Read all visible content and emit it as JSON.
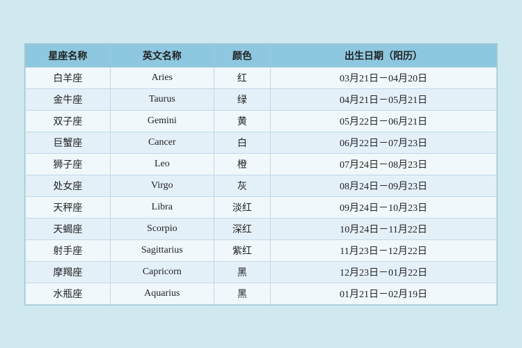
{
  "table": {
    "headers": {
      "cn_name": "星座名称",
      "en_name": "英文名称",
      "color": "颜色",
      "date_range": "出生日期（阳历）"
    },
    "rows": [
      {
        "cn": "白羊座",
        "en": "Aries",
        "color": "红",
        "date": "03月21日－04月20日"
      },
      {
        "cn": "金牛座",
        "en": "Taurus",
        "color": "绿",
        "date": "04月21日－05月21日"
      },
      {
        "cn": "双子座",
        "en": "Gemini",
        "color": "黄",
        "date": "05月22日－06月21日"
      },
      {
        "cn": "巨蟹座",
        "en": "Cancer",
        "color": "白",
        "date": "06月22日－07月23日"
      },
      {
        "cn": "狮子座",
        "en": "Leo",
        "color": "橙",
        "date": "07月24日－08月23日"
      },
      {
        "cn": "处女座",
        "en": "Virgo",
        "color": "灰",
        "date": "08月24日－09月23日"
      },
      {
        "cn": "天秤座",
        "en": "Libra",
        "color": "淡红",
        "date": "09月24日－10月23日"
      },
      {
        "cn": "天蝎座",
        "en": "Scorpio",
        "color": "深红",
        "date": "10月24日－11月22日"
      },
      {
        "cn": "射手座",
        "en": "Sagittarius",
        "color": "紫红",
        "date": "11月23日－12月22日"
      },
      {
        "cn": "摩羯座",
        "en": "Capricorn",
        "color": "黑",
        "date": "12月23日－01月22日"
      },
      {
        "cn": "水瓶座",
        "en": "Aquarius",
        "color": "黑",
        "date": "01月21日－02月19日"
      }
    ]
  }
}
